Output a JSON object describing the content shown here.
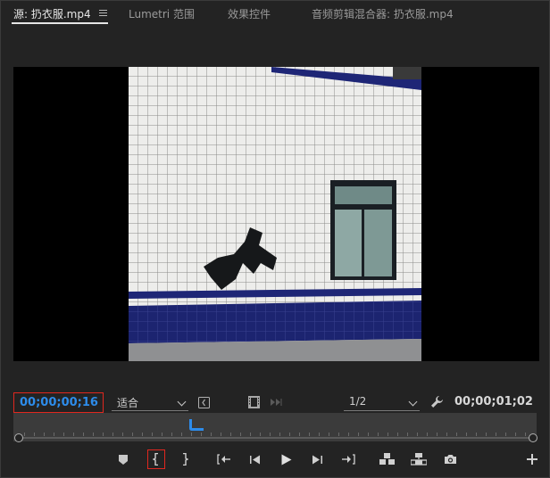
{
  "tabs": [
    {
      "label": "源: 扔衣服.mp4",
      "active": true
    },
    {
      "label": "Lumetri 范围",
      "active": false
    },
    {
      "label": "效果控件",
      "active": false
    },
    {
      "label": "音频剪辑混合器: 扔衣服.mp4",
      "active": false
    }
  ],
  "monitor": {
    "current_timecode": "00;00;00;16",
    "fit_option": "适合",
    "playback_resolution": "1/2",
    "duration_timecode": "00;00;01;02"
  },
  "timeline": {
    "playhead_fraction": 0.33
  },
  "icons": {
    "panel_menu": "hamburger-menu-icon",
    "safe_margins": "safe-margins-icon",
    "film": "film-icon",
    "settings": "wrench-icon"
  },
  "colors": {
    "timecode_blue": "#2d8ceb",
    "highlight_red": "#e0271f",
    "background": "#232323"
  },
  "transport": [
    {
      "name": "add-marker-button",
      "icon": "marker-icon"
    },
    {
      "name": "mark-in-button",
      "icon": "mark-in-icon"
    },
    {
      "name": "mark-out-button",
      "icon": "mark-out-icon"
    },
    {
      "name": "go-to-in-button",
      "icon": "go-to-in-icon"
    },
    {
      "name": "step-back-button",
      "icon": "step-back-icon"
    },
    {
      "name": "play-button",
      "icon": "play-icon"
    },
    {
      "name": "step-forward-button",
      "icon": "step-forward-icon"
    },
    {
      "name": "go-to-out-button",
      "icon": "go-to-out-icon"
    },
    {
      "name": "insert-button",
      "icon": "insert-icon"
    },
    {
      "name": "overwrite-button",
      "icon": "overwrite-icon"
    },
    {
      "name": "export-frame-button",
      "icon": "camera-icon"
    },
    {
      "name": "button-editor-button",
      "icon": "plus-icon"
    }
  ]
}
